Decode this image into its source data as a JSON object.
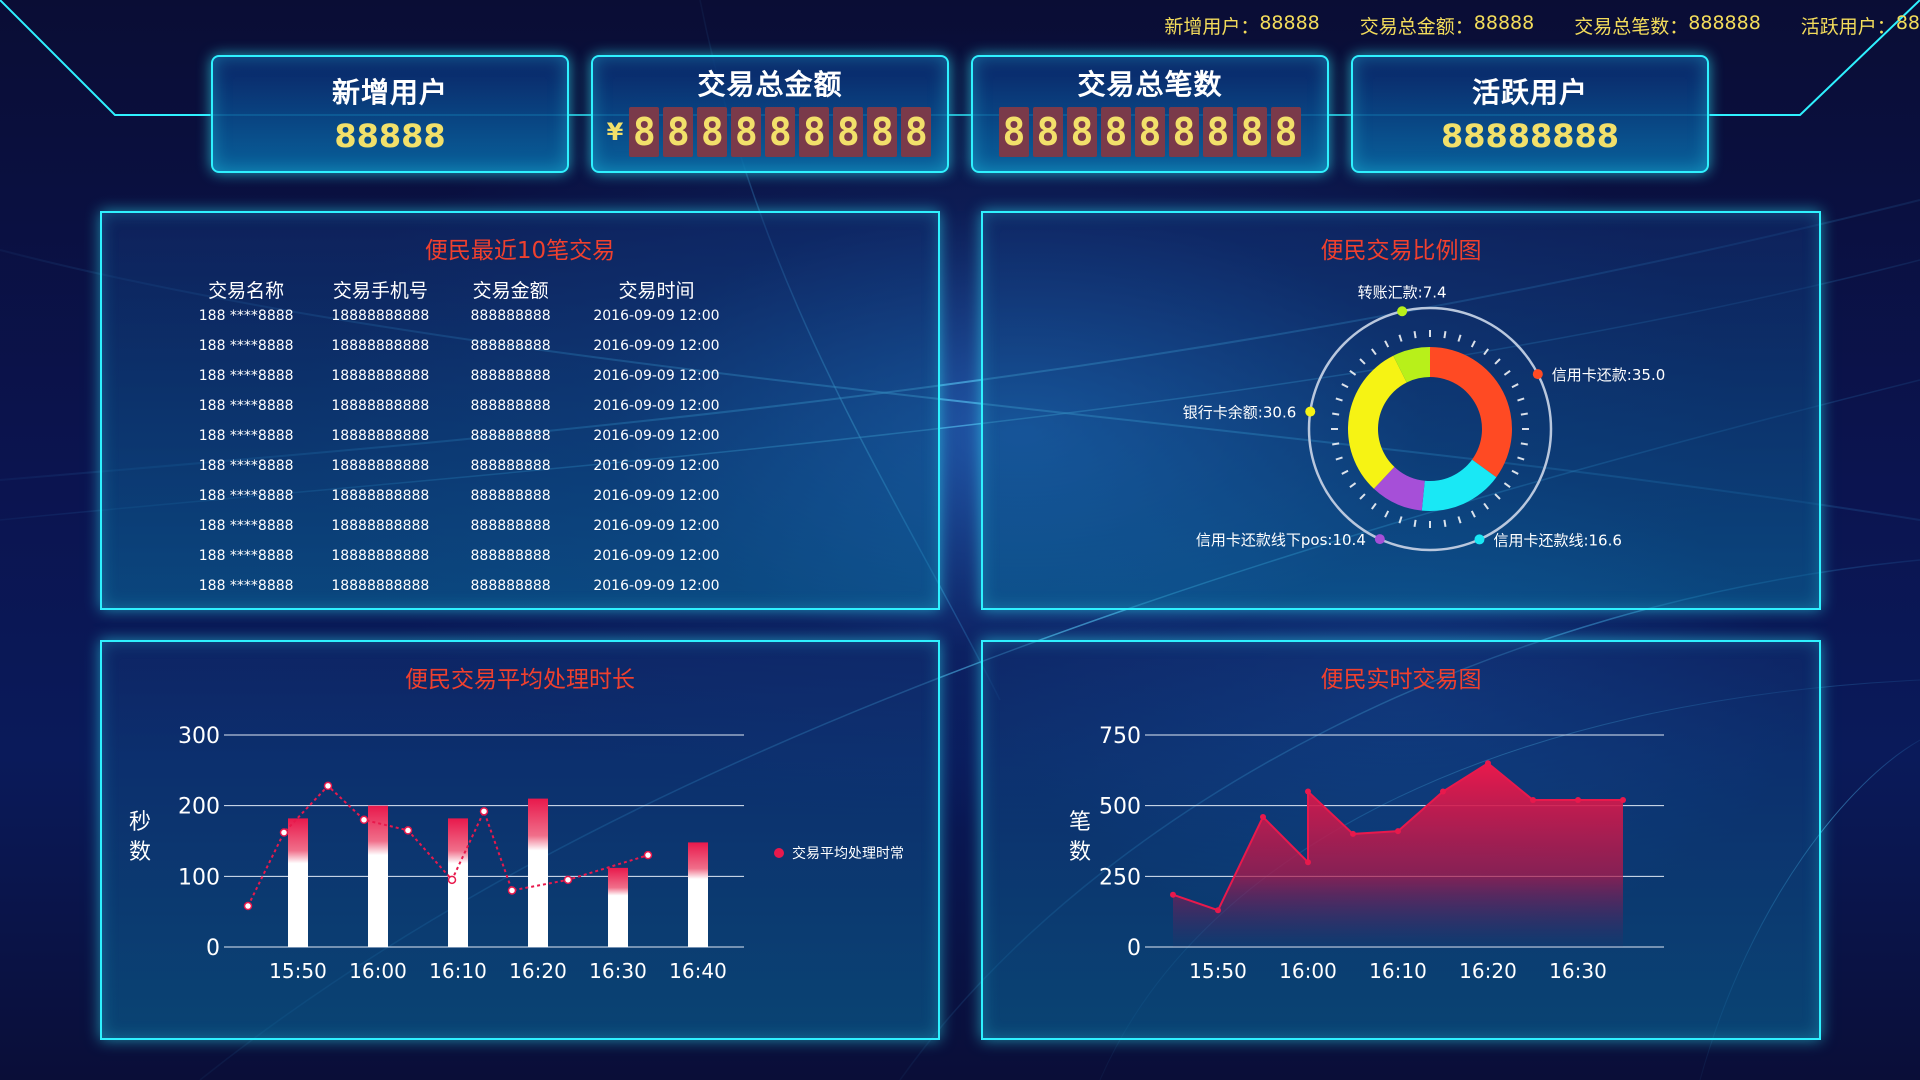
{
  "top_stats": [
    {
      "label": "新增用户：",
      "value": "88888"
    },
    {
      "label": "交易总金额：",
      "value": "88888"
    },
    {
      "label": "交易总笔数：",
      "value": "888888"
    },
    {
      "label": "活跃用户：",
      "value": "88"
    }
  ],
  "kpis": {
    "new_users": {
      "title": "新增用户",
      "value": "88888"
    },
    "total_amount": {
      "title": "交易总金额",
      "currency": "¥",
      "digits": [
        "8",
        "8",
        "8",
        "8",
        "8",
        "8",
        "8",
        "8",
        "8"
      ]
    },
    "total_count": {
      "title": "交易总笔数",
      "digits": [
        "8",
        "8",
        "8",
        "8",
        "8",
        "8",
        "8",
        "8",
        "8"
      ]
    },
    "active_users": {
      "title": "活跃用户",
      "value": "88888888"
    }
  },
  "recent_tx": {
    "title": "便民最近10笔交易",
    "columns": [
      "交易名称",
      "交易手机号",
      "交易金额",
      "交易时间"
    ],
    "rows": [
      [
        "188 ****8888",
        "18888888888",
        "888888888",
        "2016-09-09  12:00"
      ],
      [
        "188 ****8888",
        "18888888888",
        "888888888",
        "2016-09-09  12:00"
      ],
      [
        "188 ****8888",
        "18888888888",
        "888888888",
        "2016-09-09  12:00"
      ],
      [
        "188 ****8888",
        "18888888888",
        "888888888",
        "2016-09-09  12:00"
      ],
      [
        "188 ****8888",
        "18888888888",
        "888888888",
        "2016-09-09  12:00"
      ],
      [
        "188 ****8888",
        "18888888888",
        "888888888",
        "2016-09-09  12:00"
      ],
      [
        "188 ****8888",
        "18888888888",
        "888888888",
        "2016-09-09  12:00"
      ],
      [
        "188 ****8888",
        "18888888888",
        "888888888",
        "2016-09-09  12:00"
      ],
      [
        "188 ****8888",
        "18888888888",
        "888888888",
        "2016-09-09  12:00"
      ],
      [
        "188 ****8888",
        "18888888888",
        "888888888",
        "2016-09-09  12:00"
      ]
    ]
  },
  "colors": {
    "accent": "#2ff1ff",
    "title_red": "#f0402e",
    "kpi_yellow": "#f2e06a",
    "bar_red": "#e8194c"
  },
  "chart_data": [
    {
      "type": "pie",
      "title": "便民交易比例图",
      "donut": true,
      "slices": [
        {
          "label": "信用卡还款:35.0",
          "value": 35.0,
          "color": "#ff4a23"
        },
        {
          "label": "信用卡还款线:16.6",
          "value": 16.6,
          "color": "#19e8f5"
        },
        {
          "label": "信用卡还款线下pos:10.4",
          "value": 10.4,
          "color": "#a64fd8"
        },
        {
          "label": "银行卡余额:30.6",
          "value": 30.6,
          "color": "#f6f314"
        },
        {
          "label": "转账汇款:7.4",
          "value": 7.4,
          "color": "#b8f01a"
        }
      ]
    },
    {
      "type": "bar",
      "title": "便民交易平均处理时长",
      "ylabel": "秒数",
      "ylim": [
        0,
        300
      ],
      "yticks": [
        "0",
        "100",
        "200",
        "300"
      ],
      "categories": [
        "15:50",
        "16:00",
        "16:10",
        "16:20",
        "16:30",
        "16:40"
      ],
      "series": [
        {
          "type": "bar",
          "values": [
            182,
            200,
            182,
            210,
            112,
            148
          ]
        },
        {
          "type": "line",
          "name": "交易平均处理时常",
          "x": [
            0.0,
            0.45,
            1.0,
            1.45,
            2.0,
            2.55,
            2.95,
            3.3,
            4.0,
            5.0
          ],
          "values": [
            58,
            162,
            228,
            180,
            165,
            95,
            192,
            80,
            95,
            130
          ]
        }
      ],
      "legend": "交易平均处理时常"
    },
    {
      "type": "area",
      "title": "便民实时交易图",
      "ylabel": "笔数",
      "ylim": [
        0,
        750
      ],
      "yticks": [
        "0",
        "250",
        "500",
        "750"
      ],
      "xticks": [
        "15:50",
        "16:00",
        "16:10",
        "16:20",
        "16:30"
      ],
      "x": [
        15.45,
        15.5,
        15.55,
        15.6,
        16.0,
        16.05,
        16.1,
        16.15,
        16.2,
        16.25,
        16.3,
        16.35
      ],
      "values": [
        185,
        130,
        460,
        300,
        550,
        400,
        410,
        550,
        650,
        520,
        520,
        520
      ]
    }
  ]
}
